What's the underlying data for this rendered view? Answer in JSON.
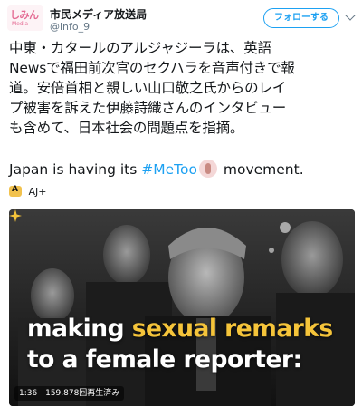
{
  "header": {
    "avatar_text": "しみん",
    "avatar_sub": "Media",
    "display_name": "市民メディア放送局",
    "handle": "@info_9",
    "follow_label": "フォローする"
  },
  "tweet": {
    "lines": [
      "中東・カタールのアルジャジーラは、英語",
      "Newsで福田前次官のセクハラを音声付きで報",
      "道。安倍首相と親しい山口敬之氏からのレイ",
      "プ被害を訴えた伊藤詩織さんのインタビュー",
      "も含めて、日本社会の問題点を指摘。"
    ],
    "en_prefix": "Japan is having its ",
    "hashtag": "#MeToo",
    "en_suffix": " movement."
  },
  "source": {
    "name": "AJ+"
  },
  "video": {
    "caption_line1_a": "making ",
    "caption_line1_b": "sexual remarks",
    "caption_line2": "to a female reporter:",
    "duration": "1:36",
    "views": "159,878回再生済み",
    "highlight_color": "#f5c43a"
  },
  "colors": {
    "accent": "#1da1f2",
    "text": "#14171a",
    "muted": "#657786"
  }
}
